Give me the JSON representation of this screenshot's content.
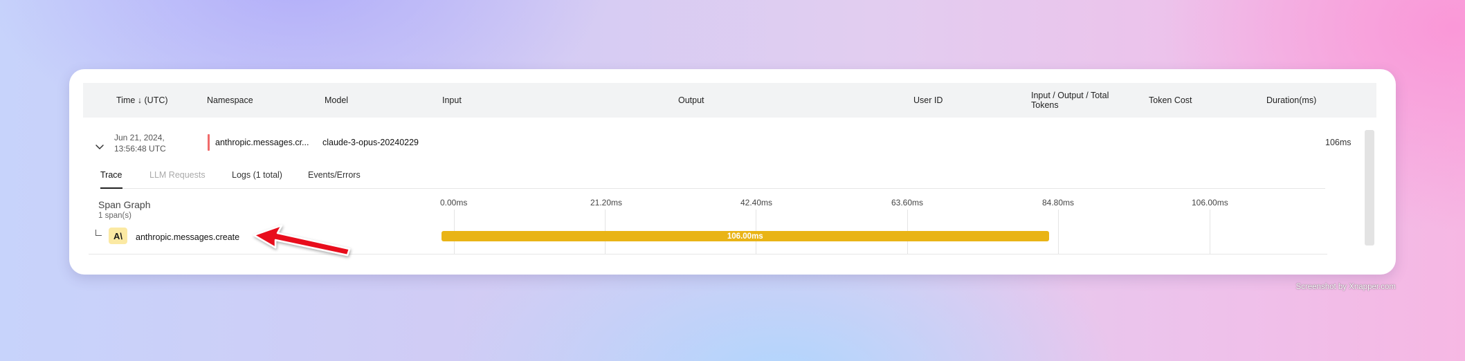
{
  "table": {
    "columns": [
      "Time ↓ (UTC)",
      "Namespace",
      "Model",
      "Input",
      "Output",
      "User ID",
      "Input / Output / Total Tokens",
      "Token Cost",
      "Duration(ms)"
    ],
    "rows": [
      {
        "date_line1": "Jun 21, 2024,",
        "date_line2": "13:56:48 UTC",
        "namespace": "anthropic.messages.cr...",
        "model": "claude-3-opus-20240229",
        "duration": "106ms"
      }
    ]
  },
  "tabs": [
    "Trace",
    "LLM Requests",
    "Logs (1 total)",
    "Events/Errors"
  ],
  "active_tab": "Trace",
  "span_graph": {
    "title": "Span Graph",
    "subtitle": "1 span(s)",
    "ticks": [
      "0.00ms",
      "21.20ms",
      "42.40ms",
      "63.60ms",
      "84.80ms",
      "106.00ms"
    ],
    "spans": [
      {
        "logo_text": "A\\",
        "name": "anthropic.messages.create",
        "start_ms": 0,
        "duration_ms": 106,
        "label": "106.00ms"
      }
    ]
  },
  "colors": {
    "namespace_marker": "#f06a6a",
    "span_bar": "#e9b416",
    "arrow": "#e8101e"
  },
  "watermark": "Screenshot by Xnapper.com"
}
